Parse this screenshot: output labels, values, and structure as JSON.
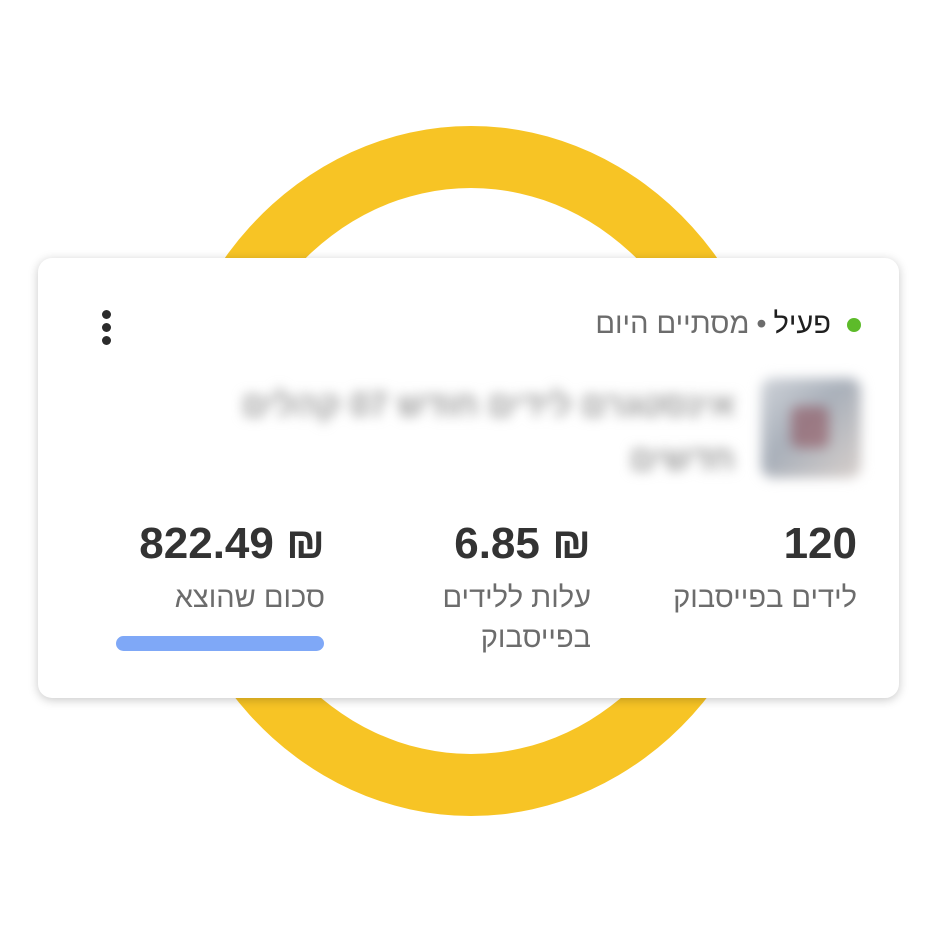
{
  "colors": {
    "ring": "#f7c425",
    "status_dot": "#5dbb2a",
    "spend_bar": "#7fa8f7"
  },
  "card": {
    "menu_icon": "more-vertical-icon",
    "status": {
      "active_label": "פעיל",
      "separator": "•",
      "end_label": "מסתיים היום"
    },
    "campaign": {
      "name": "אינסטגרם לידים חודש 07 קהלים חדשים",
      "thumbnail_icon": "campaign-thumbnail"
    },
    "metrics": [
      {
        "value": "120",
        "label": "לידים בפייסבוק"
      },
      {
        "value": "₪ 6.85",
        "label": "עלות ללידים בפייסבוק"
      },
      {
        "value": "₪ 822.49",
        "label": "סכום שהוצא"
      }
    ]
  }
}
